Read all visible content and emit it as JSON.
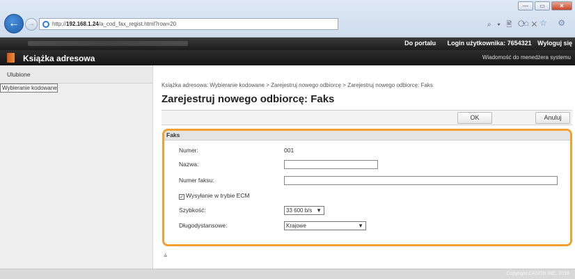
{
  "browser": {
    "address_prefix": "http://",
    "address_host": "192.168.1.24",
    "address_rest": "/a_cod_fax_regist.html?row=20",
    "back_glyph": "←",
    "forward_glyph": "→",
    "address_tools": "⌕ ▾ 🖹 ⟳ ✕",
    "fav_icons": "⌂ ☆ ⚙",
    "window_buttons": {
      "minimize": "—",
      "maximize": "▭",
      "close": "✕"
    }
  },
  "topbar": {
    "portal_link": "Do portalu",
    "login_label": "Login użytkownika: 7654321",
    "logout_link": "Wyloguj się"
  },
  "header": {
    "title": "Książka adresowa",
    "admin_message": "Wiadomość do menedżera systemu"
  },
  "sidebar": {
    "items": [
      {
        "label": "Ulubione"
      },
      {
        "label": "Wybieranie kodowane"
      }
    ]
  },
  "main": {
    "breadcrumb": "Książka adresowa: Wybieranie kodowane > Zarejestruj nowego odbiorcę > Zarejestruj nowego odbiorcę: Faks",
    "page_title": "Zarejestruj nowego odbiorcę: Faks",
    "ok_label": "OK",
    "cancel_label": "Anuluj",
    "to_top_glyph": "⩮"
  },
  "form": {
    "legend": "Faks",
    "number_label": "Numer:",
    "number_value": "001",
    "name_label": "Nazwa:",
    "name_value": "",
    "fax_label": "Numer faksu:",
    "fax_value": "",
    "ecm_label": "Wysyłanie w trybie ECM",
    "ecm_checked": true,
    "ecm_check_glyph": "✓",
    "speed_label": "Szybkość:",
    "speed_value": "33 600 b/s",
    "distance_label": "Długodystansowe:",
    "distance_value": "Krajowe",
    "dropdown_glyph": "▼"
  },
  "footer": {
    "copyright": "Copyright CANON INC. 2016"
  },
  "colors": {
    "highlight": "#f2a030",
    "header_bg": "#1d1d1d",
    "accent_icon": "#e07a2a"
  }
}
